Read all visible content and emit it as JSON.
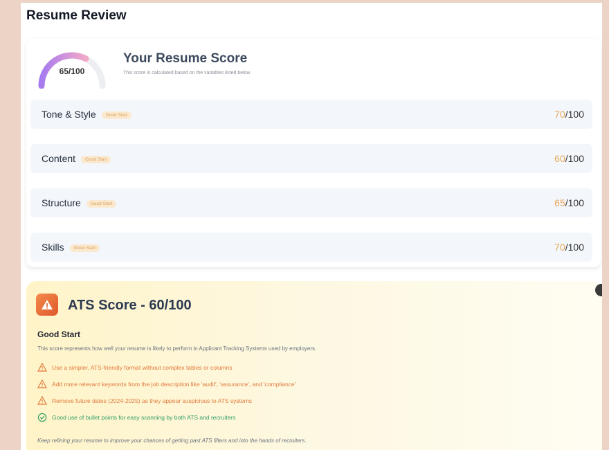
{
  "page": {
    "title": "Resume Review"
  },
  "score": {
    "value": 65,
    "label": "65/100",
    "title": "Your Resume Score",
    "subtitle": "This score is calculated based on the variables listed below"
  },
  "categories": [
    {
      "name": "Tone & Style",
      "badge": "Good Start",
      "score": "70",
      "suffix": "/100"
    },
    {
      "name": "Content",
      "badge": "Good Start",
      "score": "60",
      "suffix": "/100"
    },
    {
      "name": "Structure",
      "badge": "Good Start",
      "score": "65",
      "suffix": "/100"
    },
    {
      "name": "Skills",
      "badge": "Good Start",
      "score": "70",
      "suffix": "/100"
    }
  ],
  "ats": {
    "title": "ATS Score - 60/100",
    "subtitle": "Good Start",
    "description": "This score represents how well your resume is likely to perform in Applicant Tracking Systems used by employers.",
    "tips": [
      {
        "type": "warning",
        "text": "Use a simpler, ATS-friendly format without complex tables or columns"
      },
      {
        "type": "warning",
        "text": "Add more relevant keywords from the job description like 'audit', 'assurance', and 'compliance'"
      },
      {
        "type": "warning",
        "text": "Remove future dates (2024-2025) as they appear suspicious to ATS systems"
      },
      {
        "type": "good",
        "text": "Good use of bullet points for easy scanning by both ATS and recruiters"
      }
    ],
    "footer": "Keep refining your resume to improve your chances of getting past ATS filters and into the hands of recruiters."
  },
  "colors": {
    "accent_warning": "#e07a3d",
    "accent_good": "#2f9e67",
    "badge_text": "#d9a05a",
    "gauge_start": "#a77bf0",
    "gauge_end": "#f2a9c8"
  }
}
